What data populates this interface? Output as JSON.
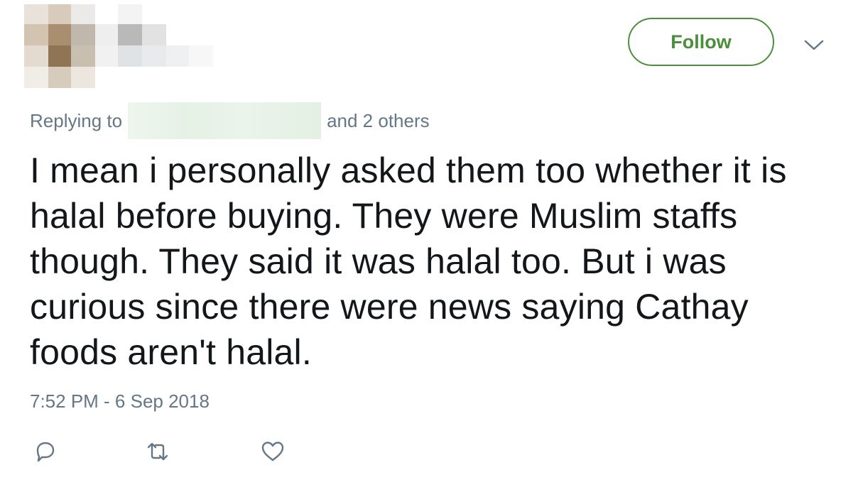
{
  "header": {
    "follow_label": "Follow",
    "more_icon": "chevron-down-icon",
    "accent_color": "#4a8f3a"
  },
  "reply_context": {
    "prefix": "Replying to",
    "others": "and 2 others"
  },
  "tweet": {
    "text": "I mean i personally asked them too whether it is halal before buying. They were Muslim staffs though. They said it was halal too. But i was curious since there were news saying Cathay foods aren't halal.",
    "timestamp": "7:52 PM - 6 Sep 2018",
    "text_color": "#14171a",
    "meta_color": "#657786"
  },
  "actions": [
    {
      "icon": "reply-icon"
    },
    {
      "icon": "retweet-icon"
    },
    {
      "icon": "like-icon"
    }
  ]
}
